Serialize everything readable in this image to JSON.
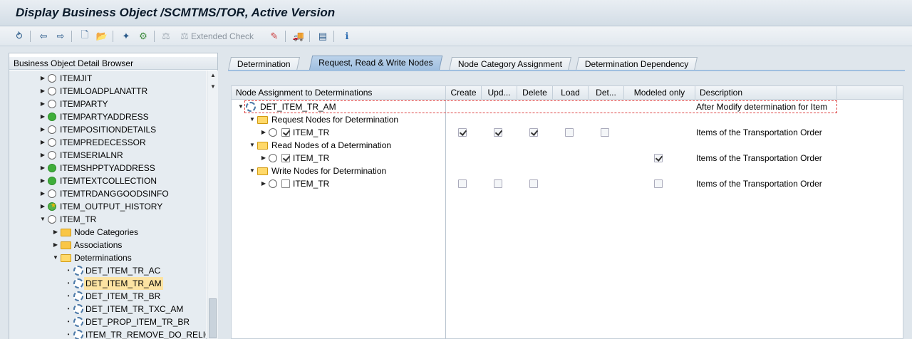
{
  "window": {
    "title": "Display Business Object /SCMTMS/TOR, Active Version"
  },
  "toolbar": {
    "extended_check_label": "Extended Check"
  },
  "left_panel": {
    "header": "Business Object Detail Browser",
    "items": [
      {
        "label": "ITEMJIT",
        "icon": "circle",
        "expand": "collapsed",
        "level": 3
      },
      {
        "label": "ITEMLOADPLANATTR",
        "icon": "circle",
        "expand": "collapsed",
        "level": 3
      },
      {
        "label": "ITEMPARTY",
        "icon": "circle",
        "expand": "collapsed",
        "level": 3
      },
      {
        "label": "ITEMPARTYADDRESS",
        "icon": "green",
        "expand": "collapsed",
        "level": 3
      },
      {
        "label": "ITEMPOSITIONDETAILS",
        "icon": "circle",
        "expand": "collapsed",
        "level": 3
      },
      {
        "label": "ITEMPREDECESSOR",
        "icon": "circle",
        "expand": "collapsed",
        "level": 3
      },
      {
        "label": "ITEMSERIALNR",
        "icon": "circle",
        "expand": "collapsed",
        "level": 3
      },
      {
        "label": "ITEMSHPPTYADDRESS",
        "icon": "green",
        "expand": "collapsed",
        "level": 3
      },
      {
        "label": "ITEMTEXTCOLLECTION",
        "icon": "green",
        "expand": "collapsed",
        "level": 3
      },
      {
        "label": "ITEMTRDANGGOODSINFO",
        "icon": "circle",
        "expand": "collapsed",
        "level": 3
      },
      {
        "label": "ITEM_OUTPUT_HISTORY",
        "icon": "star",
        "expand": "collapsed",
        "level": 3
      },
      {
        "label": "ITEM_TR",
        "icon": "circle",
        "expand": "expanded",
        "level": 3
      },
      {
        "label": "Node Categories",
        "icon": "folder",
        "expand": "collapsed",
        "level": 4
      },
      {
        "label": "Associations",
        "icon": "folder",
        "expand": "collapsed",
        "level": 4
      },
      {
        "label": "Determinations",
        "icon": "folder-open",
        "expand": "expanded",
        "level": 4
      },
      {
        "label": "DET_ITEM_TR_AC",
        "icon": "gear",
        "expand": "leaf",
        "level": 5
      },
      {
        "label": "DET_ITEM_TR_AM",
        "icon": "gear",
        "expand": "leaf",
        "level": 5,
        "selected": true
      },
      {
        "label": "DET_ITEM_TR_BR",
        "icon": "gear",
        "expand": "leaf",
        "level": 5
      },
      {
        "label": "DET_ITEM_TR_TXC_AM",
        "icon": "gear",
        "expand": "leaf",
        "level": 5
      },
      {
        "label": "DET_PROP_ITEM_TR_BR",
        "icon": "gear",
        "expand": "leaf",
        "level": 5
      },
      {
        "label": "ITEM_TR_REMOVE_DO_RELIC",
        "icon": "gear",
        "expand": "leaf",
        "level": 5
      }
    ]
  },
  "tabs": [
    {
      "label": "Determination",
      "active": false
    },
    {
      "label": "Request, Read & Write Nodes",
      "active": true
    },
    {
      "label": "Node Category Assignment",
      "active": false
    },
    {
      "label": "Determination Dependency",
      "active": false
    }
  ],
  "grid": {
    "columns": {
      "node": "Node Assignment to Determinations",
      "create": "Create",
      "update": "Upd...",
      "delete": "Delete",
      "load": "Load",
      "det": "Det...",
      "modeled": "Modeled only",
      "description": "Description"
    },
    "rows": [
      {
        "label": "DET_ITEM_TR_AM",
        "kind": "gear",
        "expand": "expanded",
        "level": 0,
        "description": "After Modify determination for Item"
      },
      {
        "label": "Request Nodes for Determination",
        "kind": "folder",
        "expand": "expanded",
        "level": 1,
        "description": ""
      },
      {
        "label": "ITEM_TR",
        "kind": "node",
        "expand": "collapsed",
        "level": 2,
        "node_checked": true,
        "checks": {
          "create": true,
          "update": true,
          "delete": true,
          "load": false,
          "det": false
        },
        "description": "Items of the Transportation Order"
      },
      {
        "label": "Read Nodes of a Determination",
        "kind": "folder",
        "expand": "expanded",
        "level": 1,
        "description": ""
      },
      {
        "label": "ITEM_TR",
        "kind": "node",
        "expand": "collapsed",
        "level": 2,
        "node_checked": true,
        "checks": {
          "modeled": true
        },
        "description": "Items of the Transportation Order"
      },
      {
        "label": "Write Nodes for Determination",
        "kind": "folder",
        "expand": "expanded",
        "level": 1,
        "description": ""
      },
      {
        "label": "ITEM_TR",
        "kind": "node",
        "expand": "collapsed",
        "level": 2,
        "node_checked": false,
        "checks": {
          "create": false,
          "update": false,
          "delete": false,
          "modeled": false
        },
        "description": "Items of the Transportation Order"
      }
    ]
  }
}
